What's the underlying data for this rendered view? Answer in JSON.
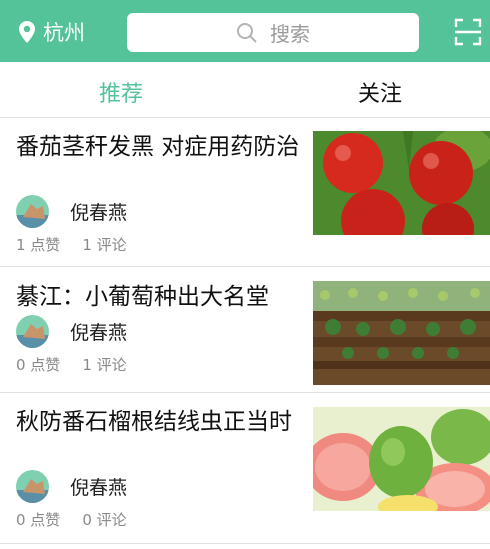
{
  "header": {
    "city": "杭州",
    "search_placeholder": "搜索",
    "icons": {
      "location": "location-pin-icon",
      "search": "search-icon",
      "scan": "scan-icon"
    }
  },
  "tabs": [
    {
      "label": "推荐",
      "active": true
    },
    {
      "label": "关注",
      "active": false
    }
  ],
  "articles": [
    {
      "title": "番茄茎秆发黑 对症用药防治",
      "author": "倪春燕",
      "likes": "1 点赞",
      "comments": "1 评论",
      "image": "tomatoes"
    },
    {
      "title": "綦江：小葡萄种出大名堂",
      "author": "倪春燕",
      "likes": "0 点赞",
      "comments": "1 评论",
      "image": "grape-vineyard"
    },
    {
      "title": "秋防番石榴根结线虫正当时",
      "author": "倪春燕",
      "likes": "0 点赞",
      "comments": "0 评论",
      "image": "guava"
    }
  ],
  "colors": {
    "accent": "#54c39a",
    "text": "#111111",
    "muted": "#8a8a8a",
    "divider": "#e1e1e1"
  }
}
